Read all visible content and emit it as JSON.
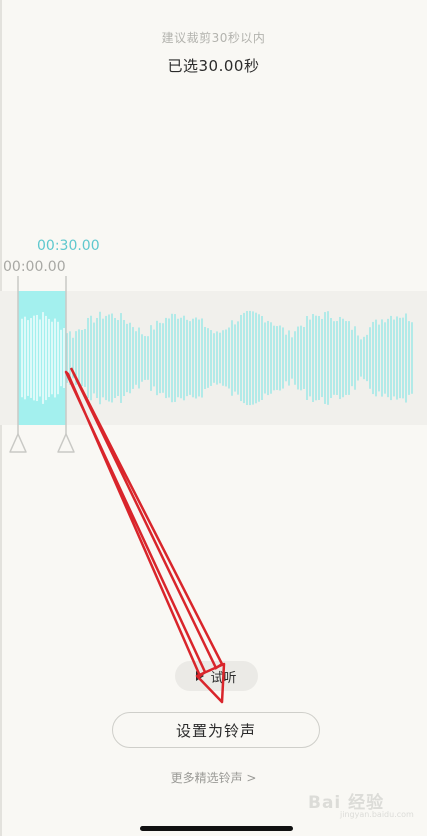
{
  "header": {
    "hint": "建议裁剪30秒以内",
    "selected_duration": "已选30.00秒"
  },
  "timeline": {
    "end_time": "00:30.00",
    "start_time": "00:00.00"
  },
  "controls": {
    "preview_label": "试听",
    "set_ringtone_label": "设置为铃声",
    "more_ringtones_label": "更多精选铃声 >"
  },
  "watermark": {
    "brand": "Bai 经验",
    "url": "jingyan.baidu.com"
  },
  "colors": {
    "accent": "#5ec8ce",
    "selection": "#a3f0ee",
    "waveform": "#8fe6e6",
    "annotation_arrow": "#d9252b",
    "background": "#f9f8f4"
  },
  "icons": {
    "play": "play-icon",
    "handle": "triangle-handle-icon"
  }
}
